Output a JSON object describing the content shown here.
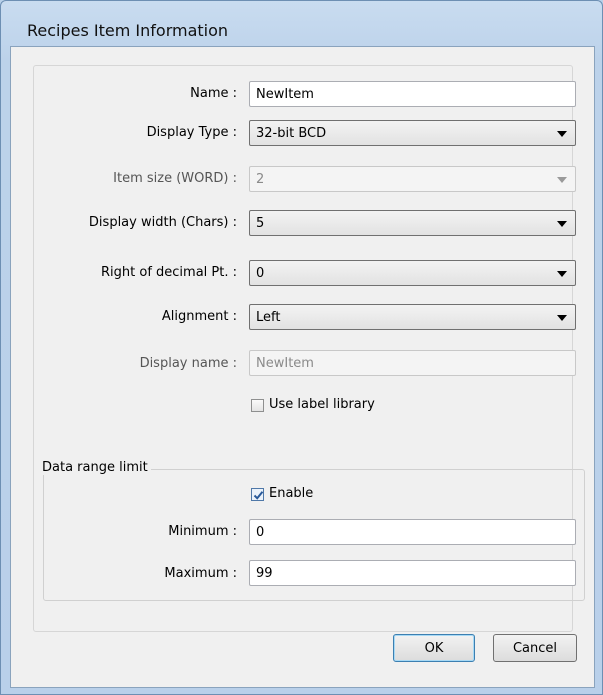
{
  "window": {
    "title": "Recipes Item Information"
  },
  "form": {
    "name": {
      "label": "Name :",
      "value": "NewItem"
    },
    "display_type": {
      "label": "Display Type :",
      "value": "32-bit BCD"
    },
    "item_size": {
      "label": "Item size (WORD) :",
      "value": "2"
    },
    "display_width": {
      "label": "Display width (Chars) :",
      "value": "5"
    },
    "decimal": {
      "label": "Right of decimal Pt. :",
      "value": "0"
    },
    "alignment": {
      "label": "Alignment :",
      "value": "Left"
    },
    "display_name": {
      "label": "Display name :",
      "value": "NewItem"
    },
    "use_label_library": {
      "label": "Use label library",
      "checked": false
    }
  },
  "range": {
    "group_title": "Data range limit",
    "enable": {
      "label": "Enable",
      "checked": true
    },
    "minimum": {
      "label": "Minimum :",
      "value": "0"
    },
    "maximum": {
      "label": "Maximum :",
      "value": "99"
    }
  },
  "buttons": {
    "ok": "OK",
    "cancel": "Cancel"
  }
}
